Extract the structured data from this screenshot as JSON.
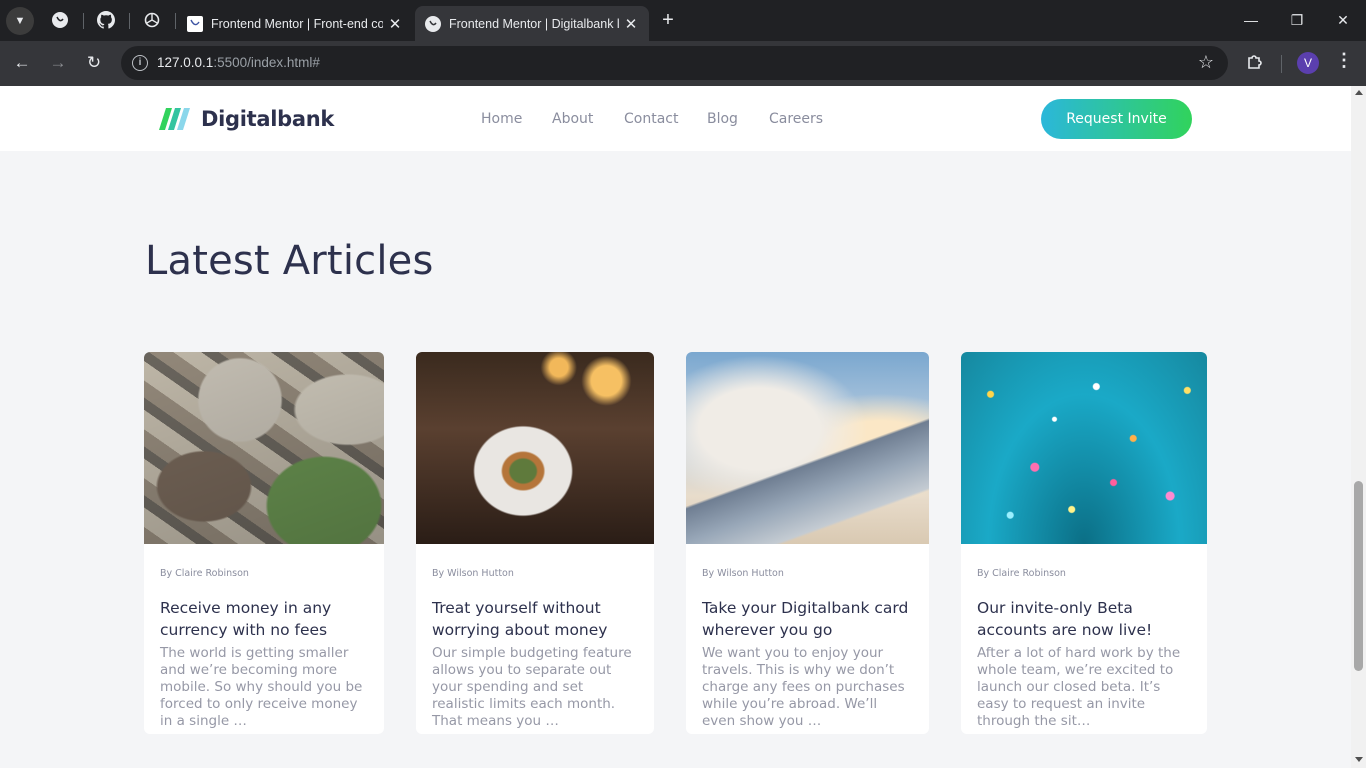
{
  "browser": {
    "tabs": [
      {
        "title": "Frontend Mentor | Front-end co",
        "active": false
      },
      {
        "title": "Frontend Mentor | Digitalbank l",
        "active": true
      }
    ],
    "new_tab": "+",
    "url_host": "127.0.0.1",
    "url_rest": ":5500/index.html#",
    "profile_initial": "V",
    "window_controls": {
      "minimize": "—",
      "restore": "❐",
      "close": "✕"
    }
  },
  "site": {
    "brand": "Digitalbank",
    "nav": [
      "Home",
      "About",
      "Contact",
      "Blog",
      "Careers"
    ],
    "cta": "Request Invite",
    "colors": {
      "dark_blue": "#2d314d",
      "lime_green": "#31d35c",
      "bright_cyan": "#2bb7da",
      "grayish_blue": "#9698a6"
    }
  },
  "articles": {
    "heading": "Latest Articles",
    "items": [
      {
        "author": "By Claire Robinson",
        "title": "Receive money in any currency with no fees",
        "excerpt": "The world is getting smaller and we’re becoming more mobile. So why should you be forced to only receive money in a single …",
        "image": "currency-banknotes"
      },
      {
        "author": "By Wilson Hutton",
        "title": "Treat yourself without worrying about money",
        "excerpt": "Our simple budgeting feature allows you to separate out your spending and set realistic limits each month. That means you …",
        "image": "restaurant-dinner"
      },
      {
        "author": "By Wilson Hutton",
        "title": "Take your Digitalbank card wherever you go",
        "excerpt": "We want you to enjoy your travels. This is why we don’t charge any fees on purchases while you’re abroad. We’ll even show you …",
        "image": "airplane-wing"
      },
      {
        "author": "By Claire Robinson",
        "title": "Our invite-only Beta accounts are now live!",
        "excerpt": "After a lot of hard work by the whole team, we’re excited to launch our closed beta. It’s easy to request an invite through the sit…",
        "image": "confetti"
      }
    ]
  }
}
